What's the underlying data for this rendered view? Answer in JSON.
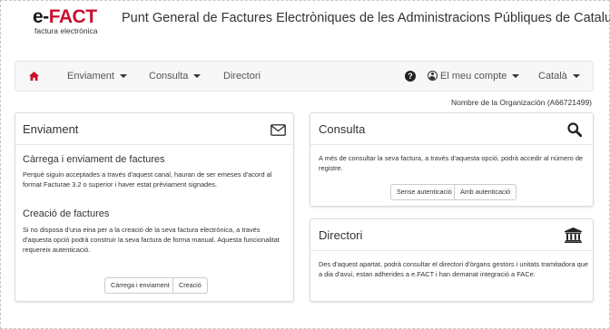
{
  "header": {
    "logo_main_prefix": "e-",
    "logo_main_accent": "FACT",
    "logo_sub": "factura electrònica",
    "title": "Punt General de Factures Electròniques de les Administracions Públiques de Catalunya"
  },
  "navbar": {
    "home_icon": "home-icon",
    "enviament": "Enviament",
    "consulta": "Consulta",
    "directori": "Directori",
    "help_icon": "?",
    "account": "El meu compte",
    "language": "Català",
    "accent_color": "#c8102e"
  },
  "organization": "Nombre de la Organización (A66721499)",
  "enviament_panel": {
    "title": "Enviament",
    "icon": "envelope-icon",
    "section1_title": "Càrrega i enviament de factures",
    "section1_text": "Perquè siguin acceptades a través d'aquest canal, hauran de ser emeses d'acord al format Facturae 3.2 o superior i haver estat prèviament signades.",
    "section2_title": "Creació de factures",
    "section2_text": "Si no disposa d'una eina per a la creació de la seva factura electrònica, a través d'aquesta opció podrà construir la seva factura de forma manual. Aquesta funcionalitat requereix autenticació.",
    "button_upload": "Càrrega i enviament",
    "button_create": "Creació"
  },
  "consulta_panel": {
    "title": "Consulta",
    "icon": "search-icon",
    "text": "A més de consultar la seva factura, a través d'aquesta opció, podrà accedir al número de registre.",
    "button_noauth": "Sense autenticació",
    "button_auth": "Amb autenticació"
  },
  "directori_panel": {
    "title": "Directori",
    "icon": "institution-icon",
    "text": "Des d'aquest apartat, podrà consultar el directori d'òrgans gestors i unitats tramitadora que a dia d'avui, estan adherides a e.FACT i han demanat integració a FACe."
  }
}
